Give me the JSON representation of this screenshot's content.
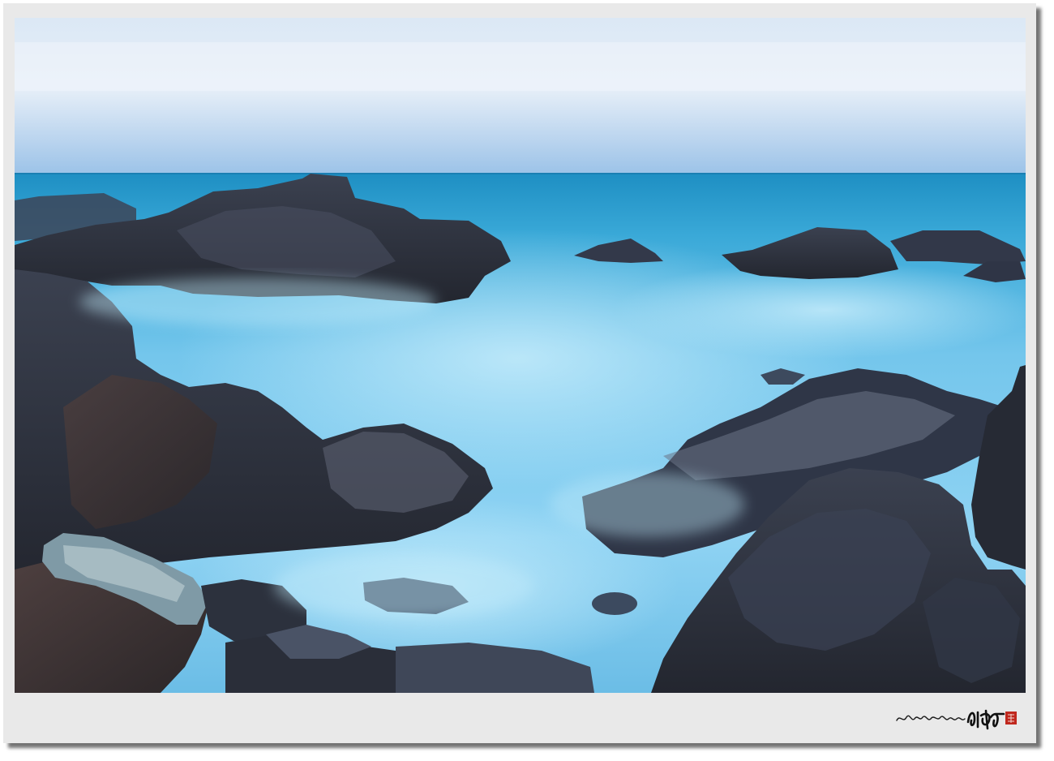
{
  "photo": {
    "subject": "long-exposure-seascape-rocks-blue-hour",
    "palette": {
      "sky_top": "#c9dcef",
      "sky_horizon": "#9ec2e6",
      "sea_far": "#1f93c4",
      "sea_mist": "#7fd0f0",
      "rock_dark": "#2a2f3d",
      "rock_warm": "#4a3a36"
    }
  },
  "signature": {
    "script_text": "바다가 있는 세상 임석규",
    "stamp_color": "#c0281e"
  }
}
